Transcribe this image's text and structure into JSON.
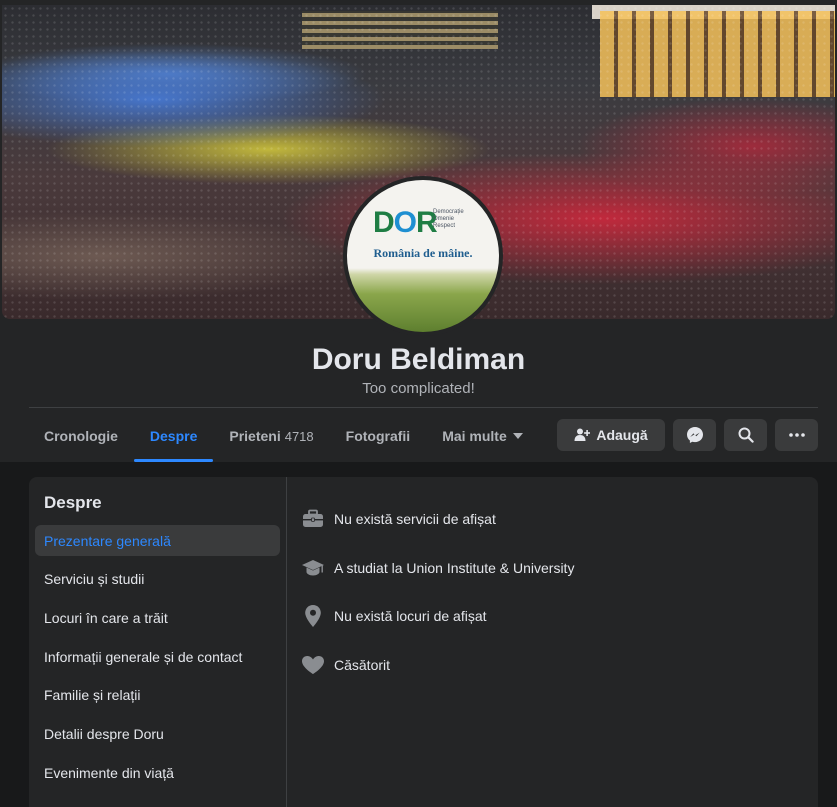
{
  "profile": {
    "name": "Doru Beldiman",
    "bio": "Too complicated!",
    "avatar": {
      "logo_text_d": "D",
      "logo_text_o": "O",
      "logo_text_r": "R",
      "tagline": [
        "Democrație",
        "Omenie",
        "Respect"
      ],
      "motto": "România de mâine."
    }
  },
  "tabs": [
    {
      "label": "Cronologie",
      "active": false
    },
    {
      "label": "Despre",
      "active": true
    },
    {
      "label": "Prieteni",
      "count": "4718",
      "active": false
    },
    {
      "label": "Fotografii",
      "active": false
    },
    {
      "label": "Mai multe",
      "active": false
    }
  ],
  "actions": {
    "add_label": "Adaugă",
    "add_icon": "add-friend-icon",
    "messenger_icon": "messenger-icon",
    "search_icon": "search-icon",
    "more_icon": "more-dots-icon"
  },
  "about": {
    "title": "Despre",
    "sidebar": [
      {
        "label": "Prezentare generală",
        "active": true
      },
      {
        "label": "Serviciu și studii"
      },
      {
        "label": "Locuri în care a trăit"
      },
      {
        "label": "Informații generale și de contact"
      },
      {
        "label": "Familie și relații"
      },
      {
        "label": "Detalii despre Doru"
      },
      {
        "label": "Evenimente din viață"
      }
    ],
    "overview": [
      {
        "icon": "briefcase-icon",
        "text": "Nu există servicii de afișat"
      },
      {
        "icon": "graduation-cap-icon",
        "text": "A studiat la Union Institute & University"
      },
      {
        "icon": "location-pin-icon",
        "text": "Nu există locuri de afișat"
      },
      {
        "icon": "heart-icon",
        "text": "Căsătorit"
      }
    ]
  },
  "colors": {
    "accent": "#2d88ff",
    "card": "#242526",
    "background": "#18191a",
    "button": "#3a3b3c"
  }
}
